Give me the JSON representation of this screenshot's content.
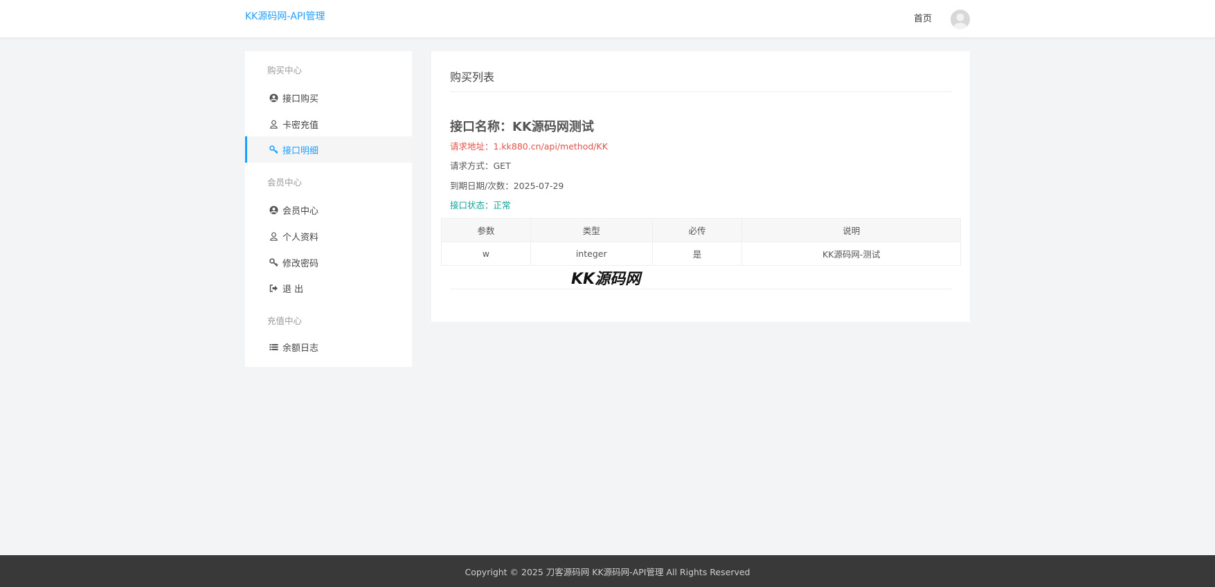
{
  "header": {
    "brand": "KK源码网-API管理",
    "nav_home": "首页"
  },
  "sidebar": {
    "groups": [
      {
        "title": "购买中心",
        "items": [
          {
            "label": "接口购买",
            "icon": "user-circle-icon"
          },
          {
            "label": "卡密充值",
            "icon": "user-outline-icon"
          },
          {
            "label": "接口明细",
            "icon": "key-icon",
            "active": true
          }
        ]
      },
      {
        "title": "会员中心",
        "items": [
          {
            "label": "会员中心",
            "icon": "user-circle-icon"
          },
          {
            "label": "个人资料",
            "icon": "user-outline-icon"
          },
          {
            "label": "修改密码",
            "icon": "key-icon"
          },
          {
            "label": "退 出",
            "icon": "sign-out-icon"
          }
        ]
      },
      {
        "title": "充值中心",
        "items": [
          {
            "label": "余额日志",
            "icon": "list-icon"
          }
        ]
      }
    ]
  },
  "main": {
    "title": "购买列表",
    "api_name": "接口名称：KK源码网测试",
    "request_url": "请求地址：1.kk880.cn/api/method/KK",
    "request_method": "请求方式：GET",
    "expire": "到期日期/次数：2025-07-29",
    "status": "接口状态：正常",
    "table": {
      "headers": [
        "参数",
        "类型",
        "必传",
        "说明"
      ],
      "rows": [
        [
          "w",
          "integer",
          "是",
          "KK源码网-测试"
        ]
      ]
    },
    "watermark": "KK源码网"
  },
  "footer": {
    "text": "Copyright © 2025 刀客源码网 KK源码网-API管理 All Rights Reserved"
  },
  "colors": {
    "accent": "#1e9fff",
    "url_red": "#e4504b",
    "status_green": "#0ea59a",
    "footer_bg": "#393939",
    "page_bg": "#f3f4f6"
  }
}
